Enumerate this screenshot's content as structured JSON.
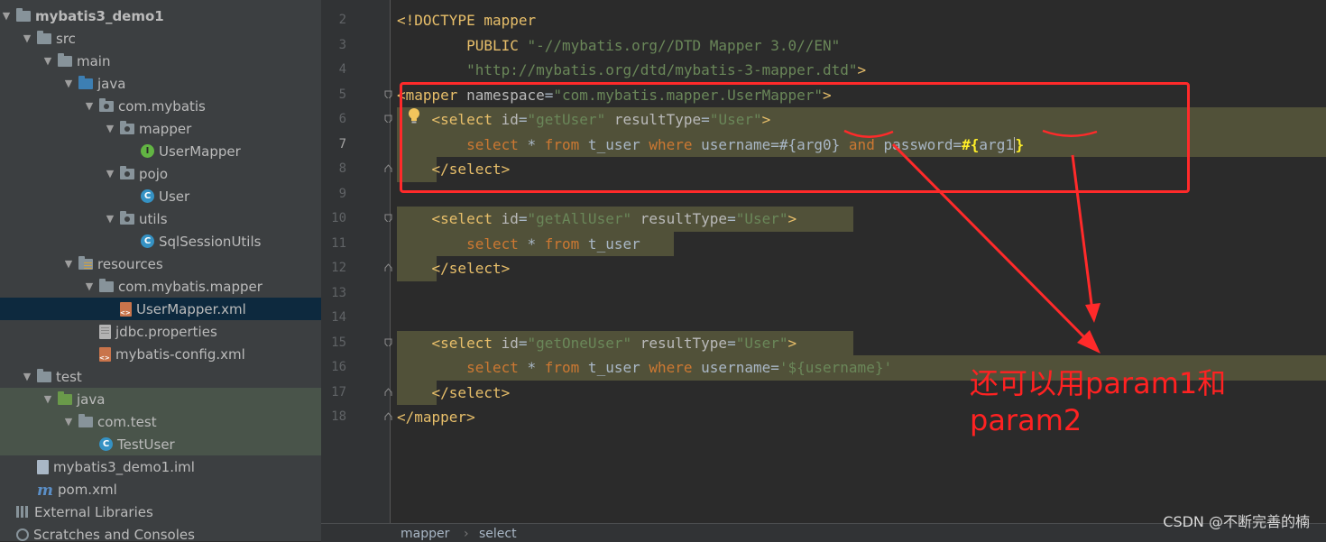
{
  "project_tree": [
    {
      "label": "mybatis3_demo1",
      "indent": 0,
      "arrow": "down",
      "icon": "project-folder-icon",
      "kind": "folder",
      "bold": true
    },
    {
      "label": "src",
      "indent": 1,
      "arrow": "down",
      "icon": "folder-icon",
      "kind": "folder"
    },
    {
      "label": "main",
      "indent": 2,
      "arrow": "down",
      "icon": "folder-icon",
      "kind": "folder"
    },
    {
      "label": "java",
      "indent": 3,
      "arrow": "down",
      "icon": "source-root-folder-icon",
      "kind": "folder-blue"
    },
    {
      "label": "com.mybatis",
      "indent": 4,
      "arrow": "down",
      "icon": "package-icon",
      "kind": "package"
    },
    {
      "label": "mapper",
      "indent": 5,
      "arrow": "down",
      "icon": "package-icon",
      "kind": "package"
    },
    {
      "label": "UserMapper",
      "indent": 6,
      "arrow": "none",
      "icon": "interface-icon",
      "kind": "interface"
    },
    {
      "label": "pojo",
      "indent": 5,
      "arrow": "down",
      "icon": "package-icon",
      "kind": "package"
    },
    {
      "label": "User",
      "indent": 6,
      "arrow": "none",
      "icon": "class-icon",
      "kind": "class"
    },
    {
      "label": "utils",
      "indent": 5,
      "arrow": "down",
      "icon": "package-icon",
      "kind": "package"
    },
    {
      "label": "SqlSessionUtils",
      "indent": 6,
      "arrow": "none",
      "icon": "class-icon",
      "kind": "class"
    },
    {
      "label": "resources",
      "indent": 3,
      "arrow": "down",
      "icon": "resources-folder-icon",
      "kind": "folder-res"
    },
    {
      "label": "com.mybatis.mapper",
      "indent": 4,
      "arrow": "down",
      "icon": "folder-icon",
      "kind": "folder"
    },
    {
      "label": "UserMapper.xml",
      "indent": 5,
      "arrow": "none",
      "icon": "xml-file-icon",
      "kind": "xml",
      "selected": true
    },
    {
      "label": "jdbc.properties",
      "indent": 4,
      "arrow": "none",
      "icon": "properties-file-icon",
      "kind": "prop"
    },
    {
      "label": "mybatis-config.xml",
      "indent": 4,
      "arrow": "none",
      "icon": "xml-file-icon",
      "kind": "xml"
    },
    {
      "label": "test",
      "indent": 1,
      "arrow": "down",
      "icon": "folder-icon",
      "kind": "folder"
    },
    {
      "label": "java",
      "indent": 2,
      "arrow": "down",
      "icon": "test-root-folder-icon",
      "kind": "folder-green",
      "test": true
    },
    {
      "label": "com.test",
      "indent": 3,
      "arrow": "down",
      "icon": "folder-icon",
      "kind": "folder",
      "test": true
    },
    {
      "label": "TestUser",
      "indent": 4,
      "arrow": "none",
      "icon": "test-class-icon",
      "kind": "class",
      "test": true
    },
    {
      "label": "mybatis3_demo1.iml",
      "indent": 1,
      "arrow": "none",
      "icon": "iml-file-icon",
      "kind": "file"
    },
    {
      "label": "pom.xml",
      "indent": 1,
      "arrow": "none",
      "icon": "maven-icon",
      "kind": "maven"
    },
    {
      "label": "External Libraries",
      "indent": 0,
      "arrow": "none",
      "icon": "libraries-icon",
      "kind": "bars"
    },
    {
      "label": "Scratches and Consoles",
      "indent": 0,
      "arrow": "none",
      "icon": "scratches-icon",
      "kind": "scratch"
    }
  ],
  "editor": {
    "line_numbers": [
      "2",
      "3",
      "4",
      "5",
      "6",
      "7",
      "8",
      "9",
      "10",
      "11",
      "12",
      "13",
      "14",
      "15",
      "16",
      "17",
      "18"
    ],
    "current_line": "7",
    "lines": [
      [
        {
          "t": "<!DOCTYPE mapper",
          "c": "tag"
        }
      ],
      [
        {
          "t": "        PUBLIC ",
          "c": "tag"
        },
        {
          "t": "\"-//mybatis.org//DTD Mapper 3.0//EN\"",
          "c": "str"
        }
      ],
      [
        {
          "t": "        ",
          "c": "plain"
        },
        {
          "t": "\"http://mybatis.org/dtd/mybatis-3-mapper.dtd\"",
          "c": "str"
        },
        {
          "t": ">",
          "c": "tag"
        }
      ],
      [
        {
          "t": "<mapper ",
          "c": "tag"
        },
        {
          "t": "namespace",
          "c": "attr"
        },
        {
          "t": "=",
          "c": "plain"
        },
        {
          "t": "\"com.mybatis.mapper.UserMapper\"",
          "c": "str"
        },
        {
          "t": ">",
          "c": "tag"
        }
      ],
      [
        {
          "t": "    ",
          "c": "plain"
        },
        {
          "t": "<select ",
          "c": "tag"
        },
        {
          "t": "id",
          "c": "attr"
        },
        {
          "t": "=",
          "c": "plain"
        },
        {
          "t": "\"getUser\"",
          "c": "str"
        },
        {
          "t": " resultType",
          "c": "attr"
        },
        {
          "t": "=",
          "c": "plain"
        },
        {
          "t": "\"User\"",
          "c": "str"
        },
        {
          "t": ">",
          "c": "tag"
        }
      ],
      [
        {
          "t": "        ",
          "c": "plain"
        },
        {
          "t": "select",
          "c": "kw"
        },
        {
          "t": " * ",
          "c": "plain"
        },
        {
          "t": "from",
          "c": "kw"
        },
        {
          "t": " t_user ",
          "c": "plain"
        },
        {
          "t": "where",
          "c": "kw"
        },
        {
          "t": " username=#{arg0} ",
          "c": "plain"
        },
        {
          "t": "and",
          "c": "kw"
        },
        {
          "t": " password=",
          "c": "plain"
        },
        {
          "t": "#{",
          "c": "braces"
        },
        {
          "t": "arg1",
          "c": "plain"
        },
        {
          "t": "}",
          "c": "braces"
        }
      ],
      [
        {
          "t": "    ",
          "c": "plain"
        },
        {
          "t": "</select>",
          "c": "tag"
        }
      ],
      [],
      [
        {
          "t": "    ",
          "c": "plain"
        },
        {
          "t": "<select ",
          "c": "tag"
        },
        {
          "t": "id",
          "c": "attr"
        },
        {
          "t": "=",
          "c": "plain"
        },
        {
          "t": "\"getAllUser\"",
          "c": "str"
        },
        {
          "t": " resultType",
          "c": "attr"
        },
        {
          "t": "=",
          "c": "plain"
        },
        {
          "t": "\"User\"",
          "c": "str"
        },
        {
          "t": ">",
          "c": "tag"
        }
      ],
      [
        {
          "t": "        ",
          "c": "plain"
        },
        {
          "t": "select",
          "c": "kw"
        },
        {
          "t": " * ",
          "c": "plain"
        },
        {
          "t": "from",
          "c": "kw"
        },
        {
          "t": " t_user",
          "c": "plain"
        }
      ],
      [
        {
          "t": "    ",
          "c": "plain"
        },
        {
          "t": "</select>",
          "c": "tag"
        }
      ],
      [],
      [],
      [
        {
          "t": "    ",
          "c": "plain"
        },
        {
          "t": "<select ",
          "c": "tag"
        },
        {
          "t": "id",
          "c": "attr"
        },
        {
          "t": "=",
          "c": "plain"
        },
        {
          "t": "\"getOneUser\"",
          "c": "str"
        },
        {
          "t": " resultType",
          "c": "attr"
        },
        {
          "t": "=",
          "c": "plain"
        },
        {
          "t": "\"User\"",
          "c": "str"
        },
        {
          "t": ">",
          "c": "tag"
        }
      ],
      [
        {
          "t": "        ",
          "c": "plain"
        },
        {
          "t": "select",
          "c": "kw"
        },
        {
          "t": " * ",
          "c": "plain"
        },
        {
          "t": "from",
          "c": "kw"
        },
        {
          "t": " t_user ",
          "c": "plain"
        },
        {
          "t": "where",
          "c": "kw"
        },
        {
          "t": " username=",
          "c": "plain"
        },
        {
          "t": "'${username}'",
          "c": "str"
        }
      ],
      [
        {
          "t": "    ",
          "c": "plain"
        },
        {
          "t": "</select>",
          "c": "tag"
        }
      ],
      [
        {
          "t": "</mapper>",
          "c": "tag"
        }
      ]
    ]
  },
  "annotation": {
    "line1": "还可以用param1和",
    "line2": "param2"
  },
  "breadcrumb": {
    "item1": "mapper",
    "separator": "›",
    "item2": "select"
  },
  "watermark": "CSDN @不断完善的楠",
  "colors": {
    "annotation_red": "#ff2a2a",
    "selection": "#0d293e",
    "highlight": "#515139"
  }
}
